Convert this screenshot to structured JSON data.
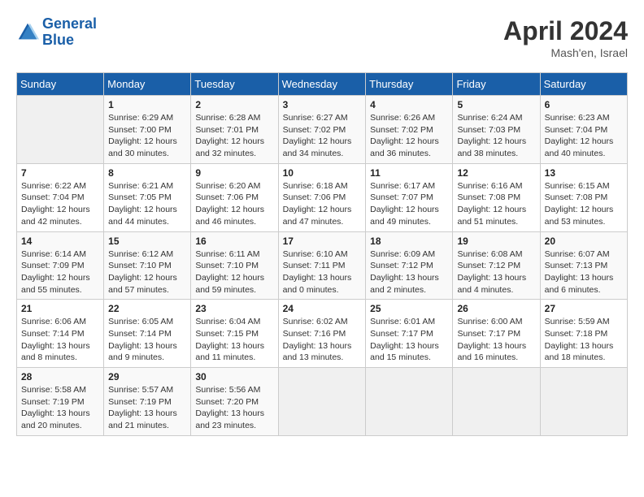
{
  "header": {
    "logo_line1": "General",
    "logo_line2": "Blue",
    "month": "April 2024",
    "location": "Mash'en, Israel"
  },
  "weekdays": [
    "Sunday",
    "Monday",
    "Tuesday",
    "Wednesday",
    "Thursday",
    "Friday",
    "Saturday"
  ],
  "weeks": [
    [
      {
        "day": "",
        "info": ""
      },
      {
        "day": "1",
        "info": "Sunrise: 6:29 AM\nSunset: 7:00 PM\nDaylight: 12 hours\nand 30 minutes."
      },
      {
        "day": "2",
        "info": "Sunrise: 6:28 AM\nSunset: 7:01 PM\nDaylight: 12 hours\nand 32 minutes."
      },
      {
        "day": "3",
        "info": "Sunrise: 6:27 AM\nSunset: 7:02 PM\nDaylight: 12 hours\nand 34 minutes."
      },
      {
        "day": "4",
        "info": "Sunrise: 6:26 AM\nSunset: 7:02 PM\nDaylight: 12 hours\nand 36 minutes."
      },
      {
        "day": "5",
        "info": "Sunrise: 6:24 AM\nSunset: 7:03 PM\nDaylight: 12 hours\nand 38 minutes."
      },
      {
        "day": "6",
        "info": "Sunrise: 6:23 AM\nSunset: 7:04 PM\nDaylight: 12 hours\nand 40 minutes."
      }
    ],
    [
      {
        "day": "7",
        "info": "Sunrise: 6:22 AM\nSunset: 7:04 PM\nDaylight: 12 hours\nand 42 minutes."
      },
      {
        "day": "8",
        "info": "Sunrise: 6:21 AM\nSunset: 7:05 PM\nDaylight: 12 hours\nand 44 minutes."
      },
      {
        "day": "9",
        "info": "Sunrise: 6:20 AM\nSunset: 7:06 PM\nDaylight: 12 hours\nand 46 minutes."
      },
      {
        "day": "10",
        "info": "Sunrise: 6:18 AM\nSunset: 7:06 PM\nDaylight: 12 hours\nand 47 minutes."
      },
      {
        "day": "11",
        "info": "Sunrise: 6:17 AM\nSunset: 7:07 PM\nDaylight: 12 hours\nand 49 minutes."
      },
      {
        "day": "12",
        "info": "Sunrise: 6:16 AM\nSunset: 7:08 PM\nDaylight: 12 hours\nand 51 minutes."
      },
      {
        "day": "13",
        "info": "Sunrise: 6:15 AM\nSunset: 7:08 PM\nDaylight: 12 hours\nand 53 minutes."
      }
    ],
    [
      {
        "day": "14",
        "info": "Sunrise: 6:14 AM\nSunset: 7:09 PM\nDaylight: 12 hours\nand 55 minutes."
      },
      {
        "day": "15",
        "info": "Sunrise: 6:12 AM\nSunset: 7:10 PM\nDaylight: 12 hours\nand 57 minutes."
      },
      {
        "day": "16",
        "info": "Sunrise: 6:11 AM\nSunset: 7:10 PM\nDaylight: 12 hours\nand 59 minutes."
      },
      {
        "day": "17",
        "info": "Sunrise: 6:10 AM\nSunset: 7:11 PM\nDaylight: 13 hours\nand 0 minutes."
      },
      {
        "day": "18",
        "info": "Sunrise: 6:09 AM\nSunset: 7:12 PM\nDaylight: 13 hours\nand 2 minutes."
      },
      {
        "day": "19",
        "info": "Sunrise: 6:08 AM\nSunset: 7:12 PM\nDaylight: 13 hours\nand 4 minutes."
      },
      {
        "day": "20",
        "info": "Sunrise: 6:07 AM\nSunset: 7:13 PM\nDaylight: 13 hours\nand 6 minutes."
      }
    ],
    [
      {
        "day": "21",
        "info": "Sunrise: 6:06 AM\nSunset: 7:14 PM\nDaylight: 13 hours\nand 8 minutes."
      },
      {
        "day": "22",
        "info": "Sunrise: 6:05 AM\nSunset: 7:14 PM\nDaylight: 13 hours\nand 9 minutes."
      },
      {
        "day": "23",
        "info": "Sunrise: 6:04 AM\nSunset: 7:15 PM\nDaylight: 13 hours\nand 11 minutes."
      },
      {
        "day": "24",
        "info": "Sunrise: 6:02 AM\nSunset: 7:16 PM\nDaylight: 13 hours\nand 13 minutes."
      },
      {
        "day": "25",
        "info": "Sunrise: 6:01 AM\nSunset: 7:17 PM\nDaylight: 13 hours\nand 15 minutes."
      },
      {
        "day": "26",
        "info": "Sunrise: 6:00 AM\nSunset: 7:17 PM\nDaylight: 13 hours\nand 16 minutes."
      },
      {
        "day": "27",
        "info": "Sunrise: 5:59 AM\nSunset: 7:18 PM\nDaylight: 13 hours\nand 18 minutes."
      }
    ],
    [
      {
        "day": "28",
        "info": "Sunrise: 5:58 AM\nSunset: 7:19 PM\nDaylight: 13 hours\nand 20 minutes."
      },
      {
        "day": "29",
        "info": "Sunrise: 5:57 AM\nSunset: 7:19 PM\nDaylight: 13 hours\nand 21 minutes."
      },
      {
        "day": "30",
        "info": "Sunrise: 5:56 AM\nSunset: 7:20 PM\nDaylight: 13 hours\nand 23 minutes."
      },
      {
        "day": "",
        "info": ""
      },
      {
        "day": "",
        "info": ""
      },
      {
        "day": "",
        "info": ""
      },
      {
        "day": "",
        "info": ""
      }
    ]
  ]
}
